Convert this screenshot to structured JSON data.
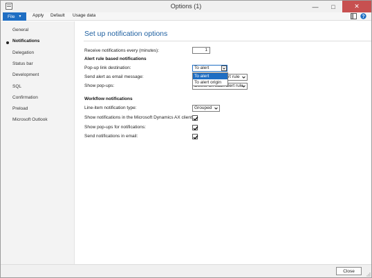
{
  "window": {
    "title": "Options (1)",
    "controls": [
      "minimize-icon",
      "maximize-icon",
      "close-icon"
    ]
  },
  "menubar": {
    "file_label": "File",
    "items": [
      "Apply",
      "Default",
      "Usage data"
    ],
    "right_icons": [
      "panel-icon",
      "help-icon"
    ]
  },
  "sidebar": {
    "items": [
      {
        "label": "General",
        "active": false
      },
      {
        "label": "Notifications",
        "active": true
      },
      {
        "label": "Delegation",
        "active": false
      },
      {
        "label": "Status bar",
        "active": false
      },
      {
        "label": "Development",
        "active": false
      },
      {
        "label": "SQL",
        "active": false
      },
      {
        "label": "Confirmation",
        "active": false
      },
      {
        "label": "Preload",
        "active": false
      },
      {
        "label": "Microsoft Outlook",
        "active": false
      }
    ]
  },
  "main": {
    "heading": "Set up notification options",
    "receive_label": "Receive notifications every (minutes):",
    "receive_value": "1",
    "alert_section": "Alert rule based notifications",
    "popup_dest_label": "Pop-up link destination:",
    "popup_dest_value": "To alert",
    "popup_dest_options": [
      "To alert",
      "To alert origin"
    ],
    "send_email_label": "Send alert as email message:",
    "send_email_value_visible": "rt rule",
    "show_popups_label": "Show pop-ups:",
    "show_popups_value": "Define on each alert rule",
    "workflow_section": "Workflow notifications",
    "line_item_label": "Line-item notification type:",
    "line_item_value": "Grouped",
    "show_in_client_label": "Show notifications in the Microsoft Dynamics AX client:",
    "show_in_client_checked": true,
    "show_popups_notif_label": "Show pop-ups for notifications:",
    "show_popups_notif_checked": true,
    "send_email_notif_label": "Send notifications in email:",
    "send_email_notif_checked": true
  },
  "footer": {
    "close_label": "Close"
  },
  "colors": {
    "accent": "#1f6ec3",
    "heading": "#1d5fa0",
    "close_button": "#c75050"
  }
}
